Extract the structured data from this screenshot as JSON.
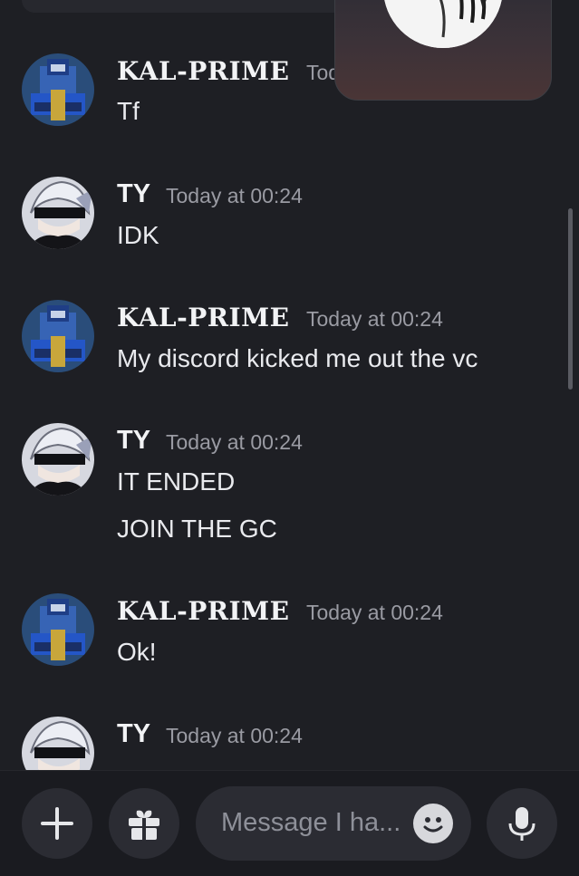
{
  "messages": [
    {
      "author": "KAL-PRIME",
      "time": "Tod",
      "lines": [
        "Tf"
      ]
    },
    {
      "author": "TY",
      "time": "Today at 00:24",
      "lines": [
        "IDK"
      ]
    },
    {
      "author": "KAL-PRIME",
      "time": "Today at 00:24",
      "lines": [
        "My discord kicked me out the vc"
      ]
    },
    {
      "author": "TY",
      "time": "Today at 00:24",
      "lines": [
        "IT ENDED",
        "JOIN THE GC"
      ]
    },
    {
      "author": "KAL-PRIME",
      "time": "Today at 00:24",
      "lines": [
        "Ok!"
      ]
    },
    {
      "author": "TY",
      "time": "Today at 00:24",
      "lines": []
    }
  ],
  "composer": {
    "placeholder": "Message I ha..."
  },
  "icons": {
    "add": "plus-icon",
    "gift": "gift-icon",
    "emoji": "emoji-icon",
    "mic": "microphone-icon"
  },
  "colors": {
    "background": "#1e1f24",
    "bar": "#1a1b20",
    "button": "#2b2c33",
    "timestamp": "#9a9ba3"
  }
}
